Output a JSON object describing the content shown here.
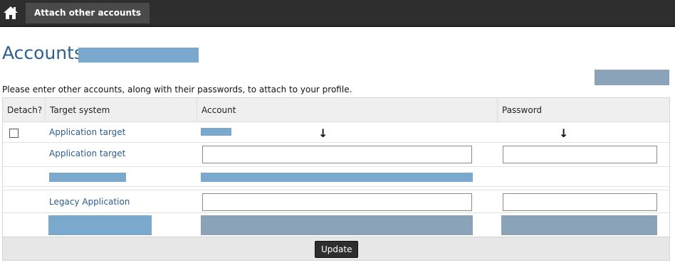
{
  "nav": {
    "home_icon": "home-icon",
    "tab_label": "Attach other accounts"
  },
  "page": {
    "title": "Accounts",
    "instruction": "Please enter other accounts, along with their passwords, to attach to your profile."
  },
  "table": {
    "columns": [
      "Detach?",
      "Target system",
      "Account",
      "Password"
    ],
    "rows": [
      {
        "target": "Application target",
        "account_value": "",
        "password_value": ""
      },
      {
        "target": "Application target",
        "account_value": "",
        "password_value": ""
      },
      {
        "target": "",
        "account_value": "",
        "password_value": ""
      },
      {
        "target": "Legacy Application",
        "account_value": "",
        "password_value": ""
      }
    ],
    "arrow_glyph": "🠗"
  },
  "footer": {
    "update_label": "Update"
  },
  "colors": {
    "topbar": "#2e2e2e",
    "title": "#2f5f8f",
    "link": "#2c5d8c",
    "redaction_blue": "#7ba9cd",
    "redaction_grey": "#8aa3b8"
  }
}
